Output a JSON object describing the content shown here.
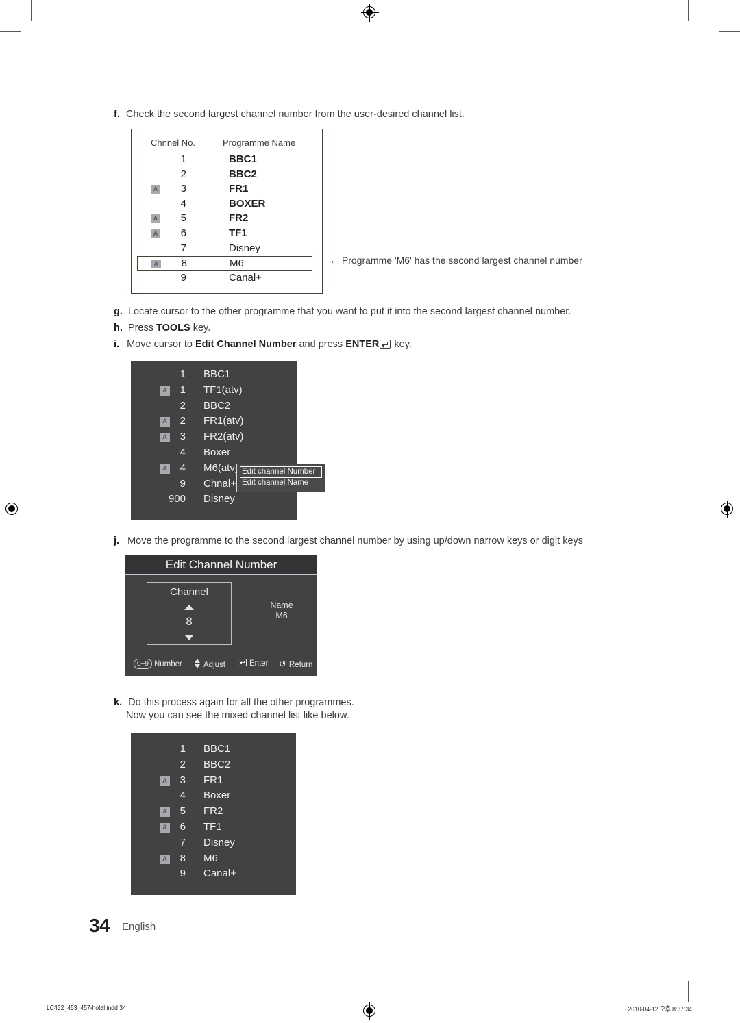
{
  "document": {
    "page_number": "34",
    "language": "English",
    "print_footer_left": "LC452_453_457-hotel.indd   34",
    "print_footer_right": "2010-04-12   오후 8:37:34"
  },
  "colors": {
    "osd_background": "#424243",
    "osd_title_background": "#343435",
    "osd_text": "#efefef",
    "badge_background": "#a7a9ac",
    "badge_text": "#54565a",
    "separator": "#c8c2d4",
    "table_border": "#4a4036",
    "body_text": "#3a3a3c"
  },
  "steps": {
    "f": {
      "letter": "f.",
      "text": "Check the second largest channel number from the user-desired channel list."
    },
    "g": {
      "letter": "g.",
      "text": "Locate cursor to the other programme that you want to put it into the second largest channel number."
    },
    "h": {
      "letter": "h.",
      "text_before": "Press ",
      "highlight": "TOOLS",
      "text_after": " key."
    },
    "i": {
      "letter": "i.",
      "text_before": "Move cursor to ",
      "bold": "Edit Channel Number",
      "text_middle": " and press ",
      "key": "ENTER",
      "text_after": " key."
    },
    "j": {
      "letter": "j.",
      "text": "Move the programme to the second largest channel number by using up/down narrow keys or digit keys"
    },
    "k": {
      "letter": "k.",
      "line1": "Do this process again for all the other programmes.",
      "line2": "Now you can see the mixed channel list like below."
    }
  },
  "white_table": {
    "headers": {
      "channel_no": "Chnnel No.",
      "programme_name": "Programme Name"
    },
    "badge_label": "A",
    "rows": [
      {
        "badge": false,
        "number": "1",
        "name": "BBC1",
        "bold": true,
        "highlighted": false
      },
      {
        "badge": false,
        "number": "2",
        "name": "BBC2",
        "bold": true,
        "highlighted": false
      },
      {
        "badge": true,
        "number": "3",
        "name": "FR1",
        "bold": true,
        "highlighted": false
      },
      {
        "badge": false,
        "number": "4",
        "name": "BOXER",
        "bold": true,
        "highlighted": false
      },
      {
        "badge": true,
        "number": "5",
        "name": "FR2",
        "bold": true,
        "highlighted": false
      },
      {
        "badge": true,
        "number": "6",
        "name": "TF1",
        "bold": true,
        "highlighted": false
      },
      {
        "badge": false,
        "number": "7",
        "name": "Disney",
        "bold": false,
        "highlighted": false
      },
      {
        "badge": true,
        "number": "8",
        "name": "M6",
        "bold": false,
        "highlighted": true
      },
      {
        "badge": false,
        "number": "9",
        "name": "Canal+",
        "bold": false,
        "highlighted": false
      }
    ],
    "callout": "← Programme 'M6' has the second largest channel number"
  },
  "osd_list_middle": {
    "badge_label": "A",
    "rows": [
      {
        "badge": false,
        "number": "1",
        "name": "BBC1"
      },
      {
        "badge": true,
        "number": "1",
        "name": "TF1(atv)"
      },
      {
        "badge": false,
        "number": "2",
        "name": "BBC2"
      },
      {
        "badge": true,
        "number": "2",
        "name": "FR1(atv)"
      },
      {
        "badge": true,
        "number": "3",
        "name": "FR2(atv)"
      },
      {
        "badge": false,
        "number": "4",
        "name": "Boxer"
      },
      {
        "badge": true,
        "number": "4",
        "name": "M6(atv)"
      },
      {
        "badge": false,
        "number": "9",
        "name": "Chnal+"
      },
      {
        "badge": false,
        "number": "900",
        "name": "Disney"
      }
    ],
    "tooltip": {
      "items": [
        {
          "label": "Edit channel Number",
          "selected": true
        },
        {
          "label": "Edit channel Name",
          "selected": false
        }
      ]
    }
  },
  "dialog": {
    "title": "Edit Channel Number",
    "spinner_label": "Channel",
    "spinner_value": "8",
    "name_label": "Name",
    "name_value": "M6",
    "footer": [
      {
        "icon": "number-pill",
        "pill": "0~9",
        "label": "Number"
      },
      {
        "icon": "updown-arrows-icon",
        "label": "Adjust"
      },
      {
        "icon": "enter-key-icon",
        "label": "Enter"
      },
      {
        "icon": "return-arrow-icon",
        "glyph": "↺",
        "label": "Return"
      }
    ]
  },
  "osd_list_final": {
    "badge_label": "A",
    "rows": [
      {
        "badge": false,
        "number": "1",
        "name": "BBC1"
      },
      {
        "badge": false,
        "number": "2",
        "name": "BBC2"
      },
      {
        "badge": true,
        "number": "3",
        "name": "FR1"
      },
      {
        "badge": false,
        "number": "4",
        "name": "Boxer"
      },
      {
        "badge": true,
        "number": "5",
        "name": "FR2"
      },
      {
        "badge": true,
        "number": "6",
        "name": "TF1"
      },
      {
        "badge": false,
        "number": "7",
        "name": "Disney"
      },
      {
        "badge": true,
        "number": "8",
        "name": "M6"
      },
      {
        "badge": false,
        "number": "9",
        "name": "Canal+"
      }
    ]
  }
}
